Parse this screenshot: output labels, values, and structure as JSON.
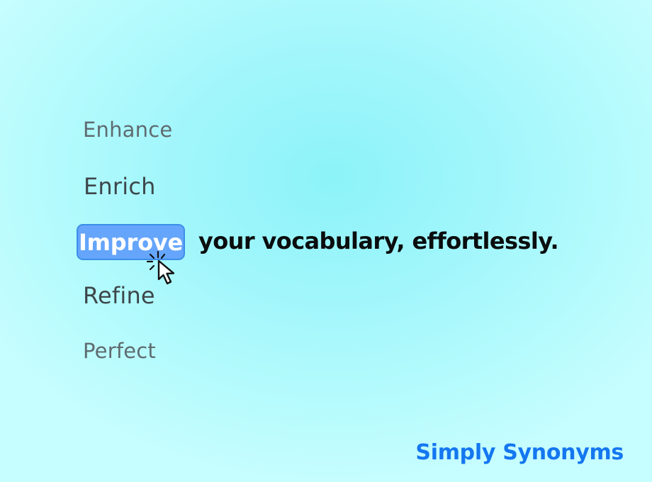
{
  "synonyms": {
    "above_2": "Enhance",
    "above_1": "Enrich",
    "selected": "Improve",
    "below_1": "Refine",
    "below_2": "Perfect"
  },
  "tagline": "your vocabulary, effortlessly.",
  "brand": "Simply Synonyms",
  "icons": {
    "cursor": "pointer-cursor-click-icon"
  },
  "colors": {
    "highlight_fill": "#65a5fb",
    "highlight_border": "#3b8fe8",
    "brand": "#1477f0",
    "background": "#a1f6fb"
  }
}
